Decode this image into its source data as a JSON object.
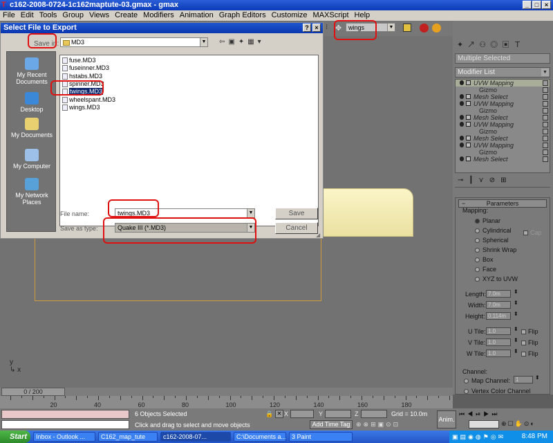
{
  "app": {
    "title": "c162-2008-0724-1c162maptute-03.gmax - gmax"
  },
  "menu": [
    "File",
    "Edit",
    "Tools",
    "Group",
    "Views",
    "Create",
    "Modifiers",
    "Animation",
    "Graph Editors",
    "Customize",
    "MAXScript",
    "Help"
  ],
  "toolbar": {
    "selection_set": "wings"
  },
  "dialog": {
    "title": "Select File to Export",
    "help_btn": "?",
    "close_btn": "×",
    "save_in_label": "Save in:",
    "save_in_value": "MD3",
    "places": [
      "My Recent Documents",
      "Desktop",
      "My Documents",
      "My Computer",
      "My Network Places"
    ],
    "files": [
      "fuse.MD3",
      "fuseinner.MD3",
      "hstabs.MD3",
      "spinner.MD3",
      "twings.MD3",
      "wheelspant.MD3",
      "wings.MD3"
    ],
    "selected_file": "twings.MD3",
    "file_name_label": "File name:",
    "file_name_value": "twings.MD3",
    "save_as_type_label": "Save as type:",
    "save_as_type_value": "Quake III (*.MD3)",
    "save_btn": "Save",
    "cancel_btn": "Cancel"
  },
  "command_panel": {
    "selected_field": "Multiple Selected",
    "modifier_list": "Modifier List",
    "stack": [
      {
        "label": "UVW Mapping",
        "kind": "mod",
        "selected": true
      },
      {
        "label": "Gizmo",
        "kind": "sub"
      },
      {
        "label": "Mesh Select",
        "kind": "mod"
      },
      {
        "label": "UVW Mapping",
        "kind": "mod"
      },
      {
        "label": "Gizmo",
        "kind": "sub"
      },
      {
        "label": "Mesh Select",
        "kind": "mod"
      },
      {
        "label": "UVW Mapping",
        "kind": "mod"
      },
      {
        "label": "Gizmo",
        "kind": "sub"
      },
      {
        "label": "Mesh Select",
        "kind": "mod"
      },
      {
        "label": "UVW Mapping",
        "kind": "mod"
      },
      {
        "label": "Gizmo",
        "kind": "sub"
      },
      {
        "label": "Mesh Select",
        "kind": "mod"
      }
    ],
    "rollout_title": "Parameters",
    "mapping_label": "Mapping:",
    "mapping_options": [
      "Planar",
      "Cylindrical",
      "Spherical",
      "Shrink Wrap",
      "Box",
      "Face",
      "XYZ to UVW"
    ],
    "cap_label": "Cap",
    "length_label": "Length:",
    "length": "7.0m",
    "width_label": "Width:",
    "width": "7.0m",
    "height_label": "Height:",
    "height": "0.114m",
    "utile_label": "U Tile:",
    "utile": "1.0",
    "vtile_label": "V Tile:",
    "vtile": "1.0",
    "wtile_label": "W Tile:",
    "wtile": "1.0",
    "flip_label": "Flip",
    "channel_label": "Channel:",
    "map_channel_label": "Map Channel:",
    "map_channel": "1",
    "vertex_color_label": "Vertex Color Channel"
  },
  "timeline": {
    "frame": "0 / 200",
    "ticks": [
      "20",
      "40",
      "60",
      "80",
      "100",
      "120",
      "140",
      "160",
      "180"
    ]
  },
  "status": {
    "objects": "6 Objects Selected",
    "prompt": "Click and drag to select and move objects",
    "x_label": "X",
    "y_label": "Y",
    "z_label": "Z",
    "grid": "Grid = 10.0m",
    "add_time_tag": "Add Time Tag",
    "anim": "Anim."
  },
  "taskbar": {
    "start": "Start",
    "tasks": [
      "Inbox - Outlook ...",
      "C162_map_tute",
      "c162-2008-07...",
      "C:\\Documents a...",
      "3 Paint"
    ],
    "clock": "8:48 PM"
  },
  "colors": {
    "annotation": "#e01010",
    "titlebar": "#0b3ab8"
  }
}
